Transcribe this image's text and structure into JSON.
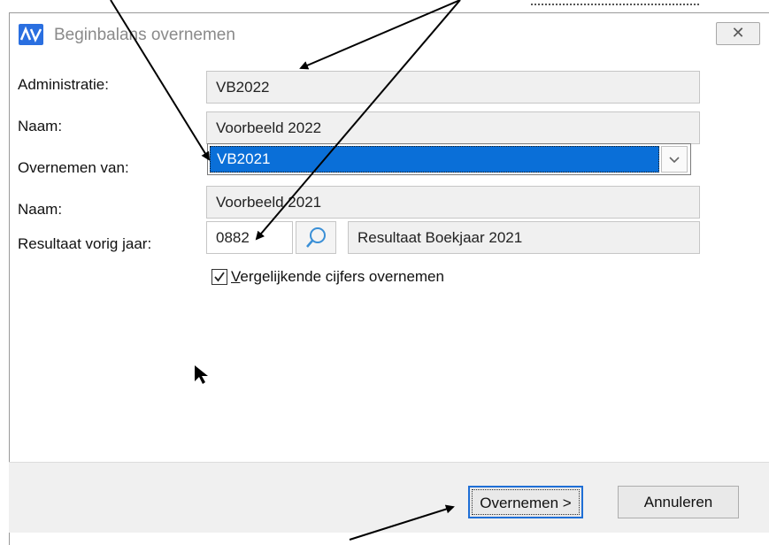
{
  "dialog": {
    "title": "Beginbalans overnemen",
    "close_glyph": "✕"
  },
  "form": {
    "administratie_label": "Administratie:",
    "administratie_value": "VB2022",
    "naam1_label": "Naam:",
    "naam1_value": "Voorbeeld 2022",
    "overnemen_label": "Overnemen van:",
    "overnemen_value": "VB2021",
    "naam2_label": "Naam:",
    "naam2_value": "Voorbeeld 2021",
    "resultaat_label": "Resultaat vorig jaar:",
    "resultaat_code": "0882",
    "resultaat_desc": "Resultaat Boekjaar 2021",
    "checkbox_label_first": "V",
    "checkbox_label_rest": "ergelijkende cijfers overnemen",
    "checkbox_checked": true
  },
  "buttons": {
    "ok_label": "Overnemen >",
    "cancel_label": "Annuleren"
  },
  "colors": {
    "selection": "#0a6fd8",
    "accent": "#1f6fd6"
  }
}
